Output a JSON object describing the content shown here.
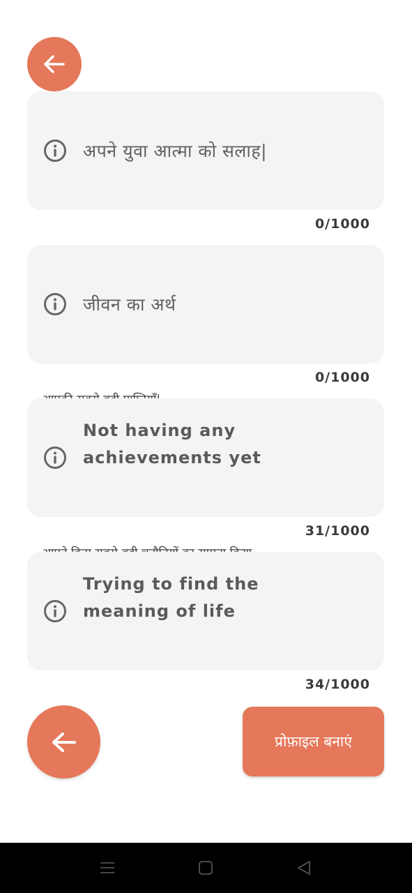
{
  "fields": [
    {
      "placeholder": "अपने युवा आत्मा को सलाह|",
      "counter": "0/1000"
    },
    {
      "placeholder": "जीवन का अर्थ",
      "counter": "0/1000"
    },
    {
      "label": "आपकी सबसे बड़ी प्राप्तियाँ|",
      "value": "Not having any achievements yet",
      "counter": "31/1000"
    },
    {
      "label": "आपने किस सबसे बड़ी चुनौतियों का सामना किया ...",
      "value": "Trying to find the meaning of life",
      "counter": "34/1000"
    }
  ],
  "buttons": {
    "create_profile": "प्रोफ़ाइल बनाएं"
  },
  "icons": {
    "back": "arrow-left-icon",
    "info": "info-icon",
    "nav_recents": "menu-icon",
    "nav_home": "square-icon",
    "nav_back": "triangle-back-icon"
  },
  "colors": {
    "accent": "#e5785a",
    "field_bg": "#f4f4f4",
    "navbar": "#000000"
  }
}
